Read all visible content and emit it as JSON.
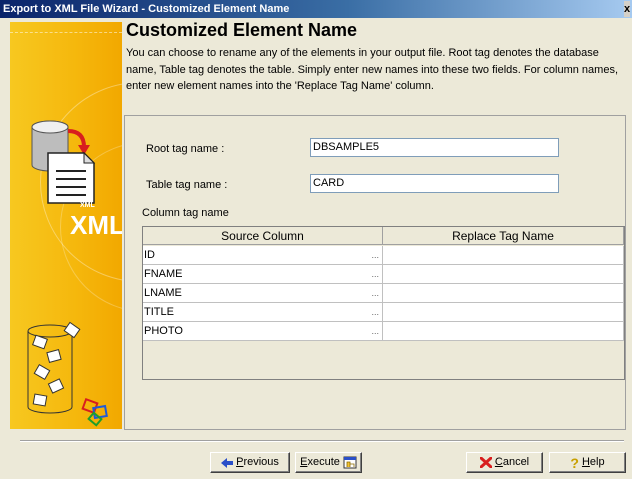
{
  "window": {
    "title": "Export to XML File Wizard - Customized Element Name",
    "close_glyph": "x"
  },
  "sidebar": {
    "xml_small": "XML",
    "xml_big": "XML",
    "icons": [
      "database-to-document-icon",
      "puzzle-pieces-icon"
    ]
  },
  "header": {
    "title": "Customized Element Name",
    "description": "You can choose to rename any of the  elements in your output file. Root tag denotes the database name, Table tag denotes the table. Simply enter new names into these two fields. For column names, enter new element names into the 'Replace Tag Name' column."
  },
  "form": {
    "root_tag_label": "Root tag name :",
    "root_tag_value": "DBSAMPLE5",
    "table_tag_label": "Table tag name :",
    "table_tag_value": "CARD",
    "column_tag_label": "Column tag name"
  },
  "grid": {
    "columns": [
      "Source Column",
      "Replace Tag Name"
    ],
    "rows": [
      {
        "source": "ID",
        "dots": "...",
        "replace": ""
      },
      {
        "source": "FNAME",
        "dots": "...",
        "replace": ""
      },
      {
        "source": "LNAME",
        "dots": "...",
        "replace": ""
      },
      {
        "source": "TITLE",
        "dots": "...",
        "replace": ""
      },
      {
        "source": "PHOTO",
        "dots": "...",
        "replace": ""
      }
    ]
  },
  "buttons": {
    "previous_first": "P",
    "previous_rest": "revious",
    "execute_first": "E",
    "execute_rest": "xecute",
    "cancel_first": "C",
    "cancel_rest": "ancel",
    "help_first": "H",
    "help_rest": "elp"
  },
  "colors": {
    "titlebar_start": "#0A246A",
    "sidebar_yellow": "#F5B70C",
    "dialog_bg": "#ECE9D8"
  }
}
